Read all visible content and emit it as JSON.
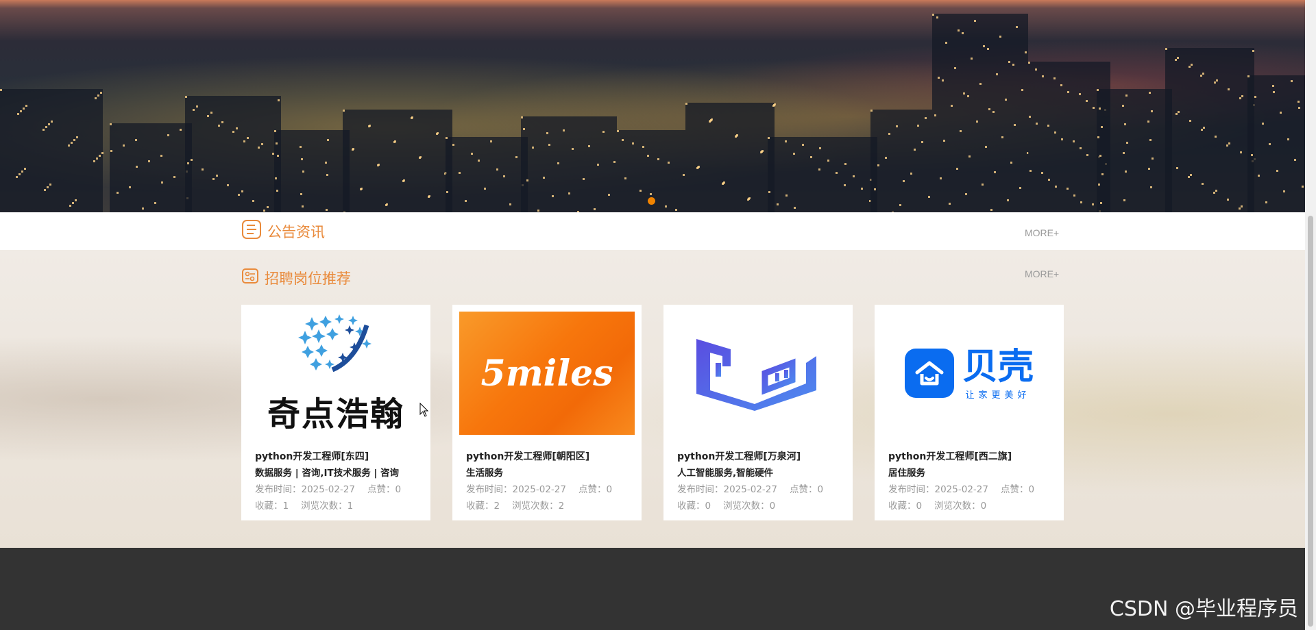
{
  "notice": {
    "title": "公告资讯",
    "more": "MORE+"
  },
  "recommend": {
    "title": "招聘岗位推荐",
    "more": "MORE+"
  },
  "jobs": [
    {
      "logo": "奇点浩翰",
      "title": "python开发工程师[东四]",
      "category": "数据服务 | 咨询,IT技术服务 | 咨询",
      "publish": "发布时间：2025-02-27",
      "likes": "点赞：0",
      "favorites": "收藏：1",
      "views": "浏览次数：1"
    },
    {
      "logo": "5miles",
      "title": "python开发工程师[朝阳区]",
      "category": "生活服务",
      "publish": "发布时间：2025-02-27",
      "likes": "点赞：0",
      "favorites": "收藏：2",
      "views": "浏览次数：2"
    },
    {
      "logo": "",
      "title": "python开发工程师[万泉河]",
      "category": "人工智能服务,智能硬件",
      "publish": "发布时间：2025-02-27",
      "likes": "点赞：0",
      "favorites": "收藏：0",
      "views": "浏览次数：0"
    },
    {
      "logo": "贝壳",
      "logo_sub": "让家更美好",
      "title": "python开发工程师[西二旗]",
      "category": "居住服务",
      "publish": "发布时间：2025-02-27",
      "likes": "点赞：0",
      "favorites": "收藏：0",
      "views": "浏览次数：0"
    }
  ],
  "watermark": "CSDN @毕业程序员",
  "colors": {
    "accent": "#e98a3b",
    "banner_dot": "#f08300",
    "footer": "#333333",
    "beike_blue": "#0a6cf0",
    "fivemiles_orange": "#f7760c"
  }
}
